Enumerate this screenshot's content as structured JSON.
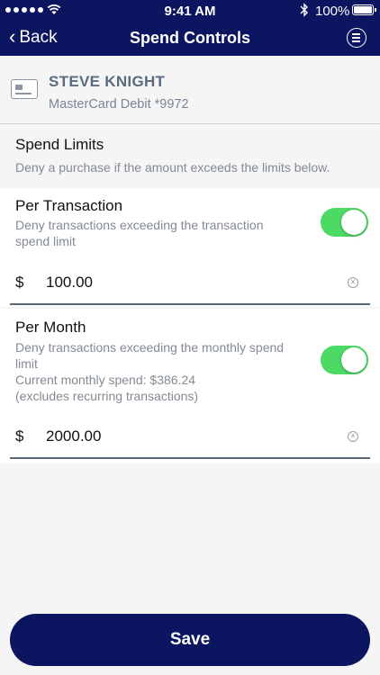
{
  "status_bar": {
    "time": "9:41 AM",
    "battery": "100%",
    "icons": [
      "signal-dots",
      "wifi-icon",
      "bluetooth-icon",
      "battery-icon"
    ]
  },
  "nav": {
    "back_label": "Back",
    "title": "Spend Controls",
    "menu_icon": "menu-icon"
  },
  "card": {
    "name": "STEVE KNIGHT",
    "description": "MasterCard Debit *9972",
    "icon": "credit-card-icon"
  },
  "spend_limits": {
    "heading": "Spend Limits",
    "subtitle": "Deny a purchase if the amount exceeds the limits below."
  },
  "per_transaction": {
    "title": "Per Transaction",
    "description": "Deny transactions exceeding the transaction spend limit",
    "enabled": true,
    "currency": "$",
    "amount": "100.00"
  },
  "per_month": {
    "title": "Per Month",
    "description": "Deny transactions exceeding the monthly spend limit",
    "current_spend": "Current monthly spend: $386.24",
    "note": "(excludes recurring transactions)",
    "enabled": true,
    "currency": "$",
    "amount": "2000.00"
  },
  "save_label": "Save",
  "colors": {
    "navy": "#0c1560",
    "toggle_on": "#4cd964",
    "muted_text": "#838a93",
    "background": "#f5f5f6"
  }
}
